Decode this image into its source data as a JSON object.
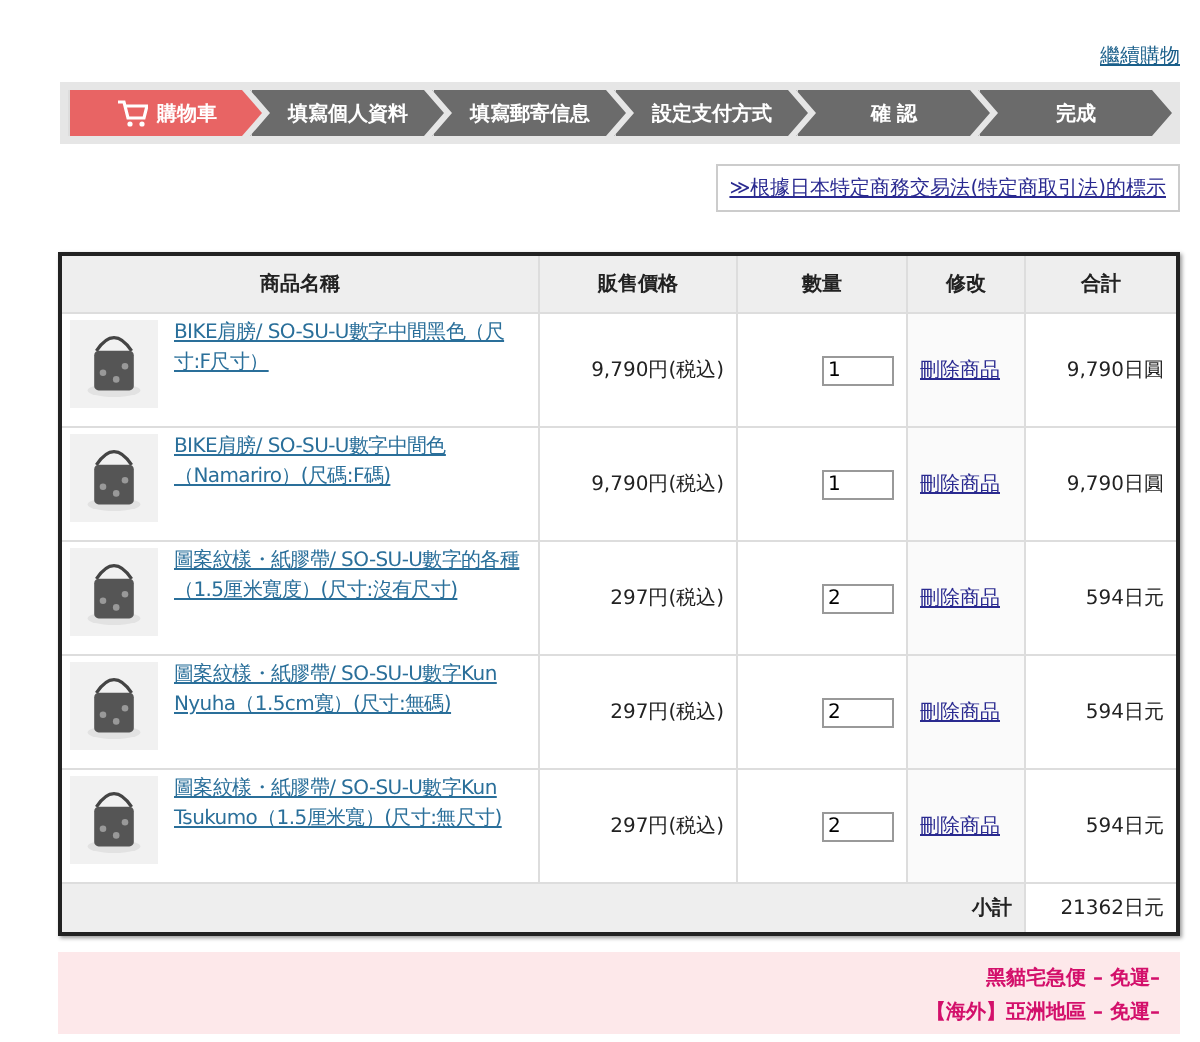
{
  "continue_link": "繼續購物",
  "steps": [
    {
      "label": "購物車",
      "selected": true
    },
    {
      "label": "填寫個人資料",
      "selected": false
    },
    {
      "label": "填寫郵寄信息",
      "selected": false
    },
    {
      "label": "設定支付方式",
      "selected": false
    },
    {
      "label": "確 認",
      "selected": false
    },
    {
      "label": "完成",
      "selected": false
    }
  ],
  "legal_link": "≫根據日本特定商務交易法(特定商取引法)的標示",
  "table": {
    "columns": [
      "商品名稱",
      "販售價格",
      "數量",
      "修改",
      "合計"
    ],
    "rows": [
      {
        "name": "BIKE肩膀/ SO-SU-U數字中間黑色（尺寸:F尺寸）",
        "price": "9,790円(税込)",
        "quantity": "1",
        "action": "刪除商品",
        "total": "9,790日圓"
      },
      {
        "name": "BIKE肩膀/ SO-SU-U數字中間色（Namariro）(尺碼:F碼)",
        "price": "9,790円(税込)",
        "quantity": "1",
        "action": "刪除商品",
        "total": "9,790日圓"
      },
      {
        "name": "圖案紋樣・紙膠帶/ SO-SU-U數字的各種（1.5厘米寬度）(尺寸:沒有尺寸)",
        "price": "297円(税込)",
        "quantity": "2",
        "action": "刪除商品",
        "total": "594日元"
      },
      {
        "name": "圖案紋樣・紙膠帶/ SO-SU-U數字Kun Nyuha（1.5cm寬）(尺寸:無碼)",
        "price": "297円(税込)",
        "quantity": "2",
        "action": "刪除商品",
        "total": "594日元"
      },
      {
        "name": "圖案紋樣・紙膠帶/ SO-SU-U數字Kun Tsukumo（1.5厘米寬）(尺寸:無尺寸)",
        "price": "297円(税込)",
        "quantity": "2",
        "action": "刪除商品",
        "total": "594日元"
      }
    ],
    "subtotal_label": "小計",
    "subtotal": "21362日元"
  },
  "shipping": [
    "黑貓宅急便 – 免運–",
    "【海外】亞洲地區 – 免運–"
  ]
}
